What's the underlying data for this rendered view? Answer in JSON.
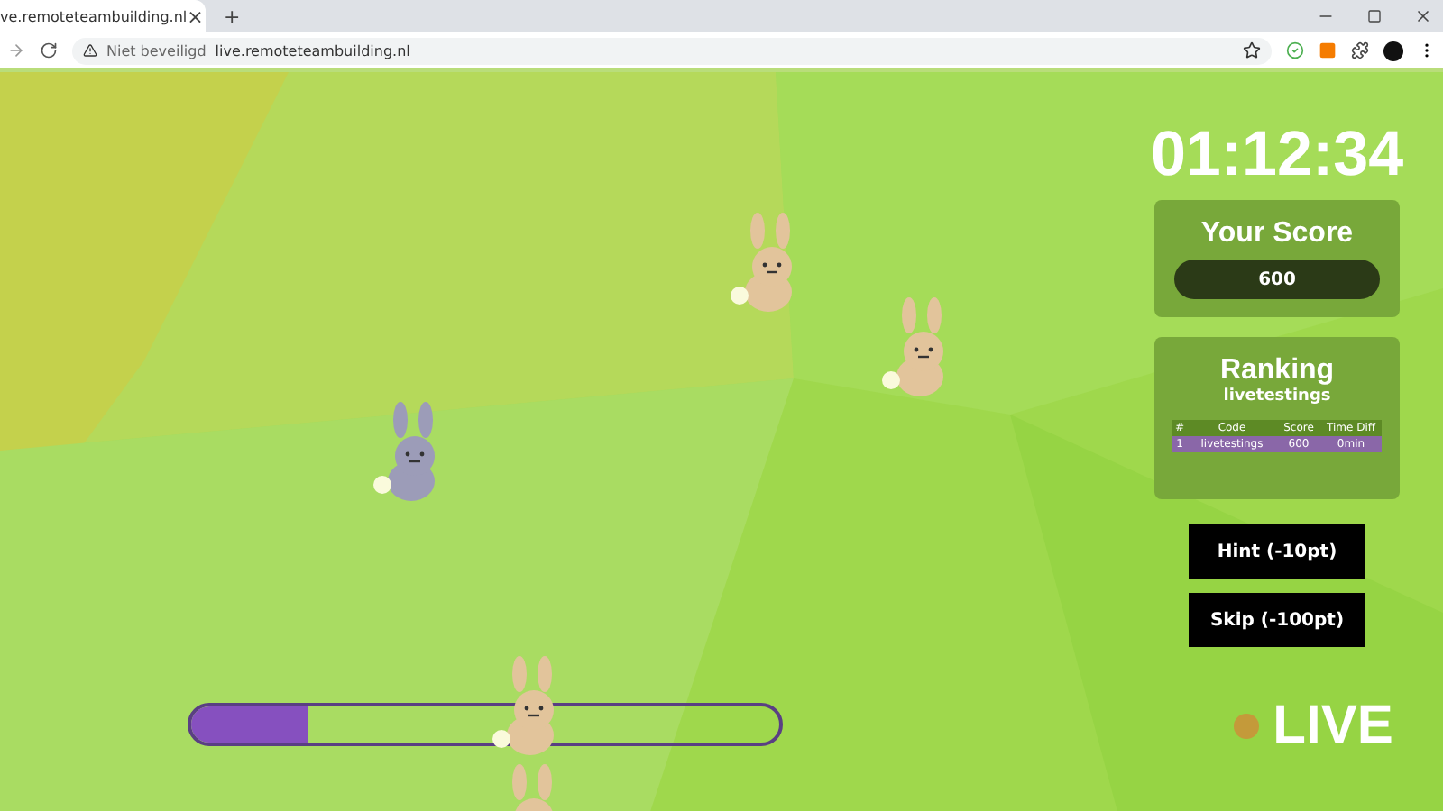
{
  "browser": {
    "tab_title": "ve.remoteteambuilding.nl",
    "tab_close": "×",
    "new_tab": "+",
    "security": "Niet beveiligd",
    "url": "live.remoteteambuilding.nl"
  },
  "bunnies": [
    {
      "color": "#e2c49b"
    },
    {
      "color": "#e2c49b"
    },
    {
      "color": "#9c9cb8"
    },
    {
      "color": "#e2c49b"
    },
    {
      "color": "#e2c49b"
    }
  ],
  "progress": {
    "level": 0.2
  },
  "timer": "01:12:34",
  "score": {
    "title": "Your Score",
    "value": "600"
  },
  "ranking": {
    "title": "Ranking",
    "subtitle": "livetestings",
    "columns": [
      "#",
      "Code",
      "Score",
      "Time Diff"
    ],
    "rows": [
      {
        "cells": [
          "1",
          "livetestings",
          "600",
          "0min"
        ],
        "selected": true
      }
    ]
  },
  "buttons": [
    "Hint (-10pt)",
    "Skip (-100pt)"
  ],
  "live": {
    "label": "LIVE",
    "on": true
  }
}
